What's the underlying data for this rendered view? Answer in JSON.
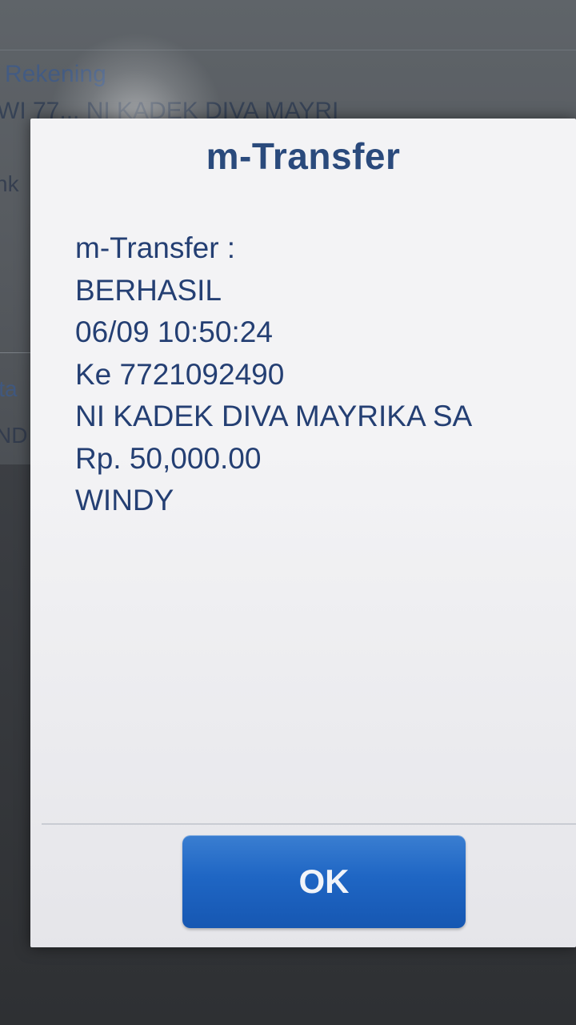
{
  "background": {
    "rekening_label": "Rekening",
    "account_text": "WI 77... NI KADEK DIVA MAYRI",
    "fragment_1": "nk",
    "fragment_2": "ita",
    "fragment_3": "ND"
  },
  "dialog": {
    "title": "m-Transfer",
    "message_lines": [
      "m-Transfer :",
      "BERHASIL",
      "06/09 10:50:24",
      "Ke 7721092490",
      "NI KADEK DIVA MAYRIKA SA",
      "Rp. 50,000.00",
      "WINDY"
    ],
    "ok_label": "OK"
  },
  "colors": {
    "title": "#2a4a7c",
    "message_text": "#243f73",
    "button": "#1f66c4",
    "dialog_bg": "#f3f3f5"
  }
}
